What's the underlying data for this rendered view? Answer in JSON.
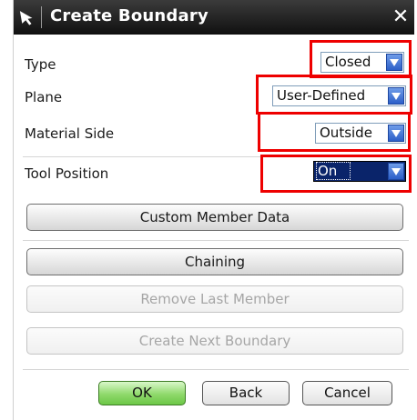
{
  "dialog": {
    "title": "Create Boundary",
    "close_glyph": "✕"
  },
  "fields": {
    "type": {
      "label": "Type",
      "value": "Closed"
    },
    "plane": {
      "label": "Plane",
      "value": "User-Defined"
    },
    "material_side": {
      "label": "Material Side",
      "value": "Outside"
    },
    "tool_position": {
      "label": "Tool Position",
      "value": "On"
    }
  },
  "buttons": {
    "custom_member_data": "Custom Member Data",
    "chaining": "Chaining",
    "remove_last_member": "Remove Last Member",
    "create_next_boundary": "Create Next Boundary",
    "ok": "OK",
    "back": "Back",
    "cancel": "Cancel"
  },
  "colors": {
    "highlight": "#ee0000",
    "ok_button": "#8fd96b",
    "selected_field": "#0a246a"
  },
  "icons": {
    "title": "cursor-arrow-icon",
    "dropdown": "chevron-down-icon",
    "close": "close-icon"
  }
}
